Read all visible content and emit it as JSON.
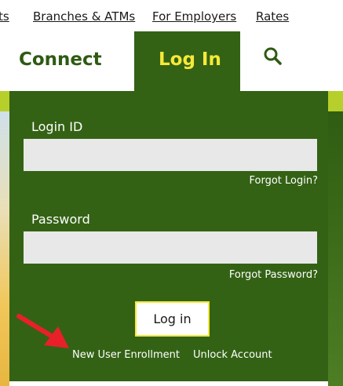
{
  "top_nav": {
    "items": [
      {
        "label": "ts"
      },
      {
        "label": "Branches & ATMs"
      },
      {
        "label": "For Employers"
      },
      {
        "label": "Rates"
      }
    ]
  },
  "main_nav": {
    "connect_label": "Connect",
    "login_tab_label": "Log In",
    "search_icon": "search-icon"
  },
  "login_form": {
    "login_id_label": "Login ID",
    "login_id_value": "",
    "forgot_login": "Forgot Login?",
    "password_label": "Password",
    "password_value": "",
    "forgot_password": "Forgot Password?",
    "submit_label": "Log in",
    "new_user": "New User Enrollment",
    "unlock": "Unlock Account"
  },
  "annotation": {
    "arrow_icon": "red-arrow-icon",
    "arrow_color": "#e8202a"
  },
  "colors": {
    "brand_green": "#336214",
    "accent_yellow": "#f7e93a",
    "lime": "#b6cf2a",
    "connect_text": "#2e5a12"
  }
}
